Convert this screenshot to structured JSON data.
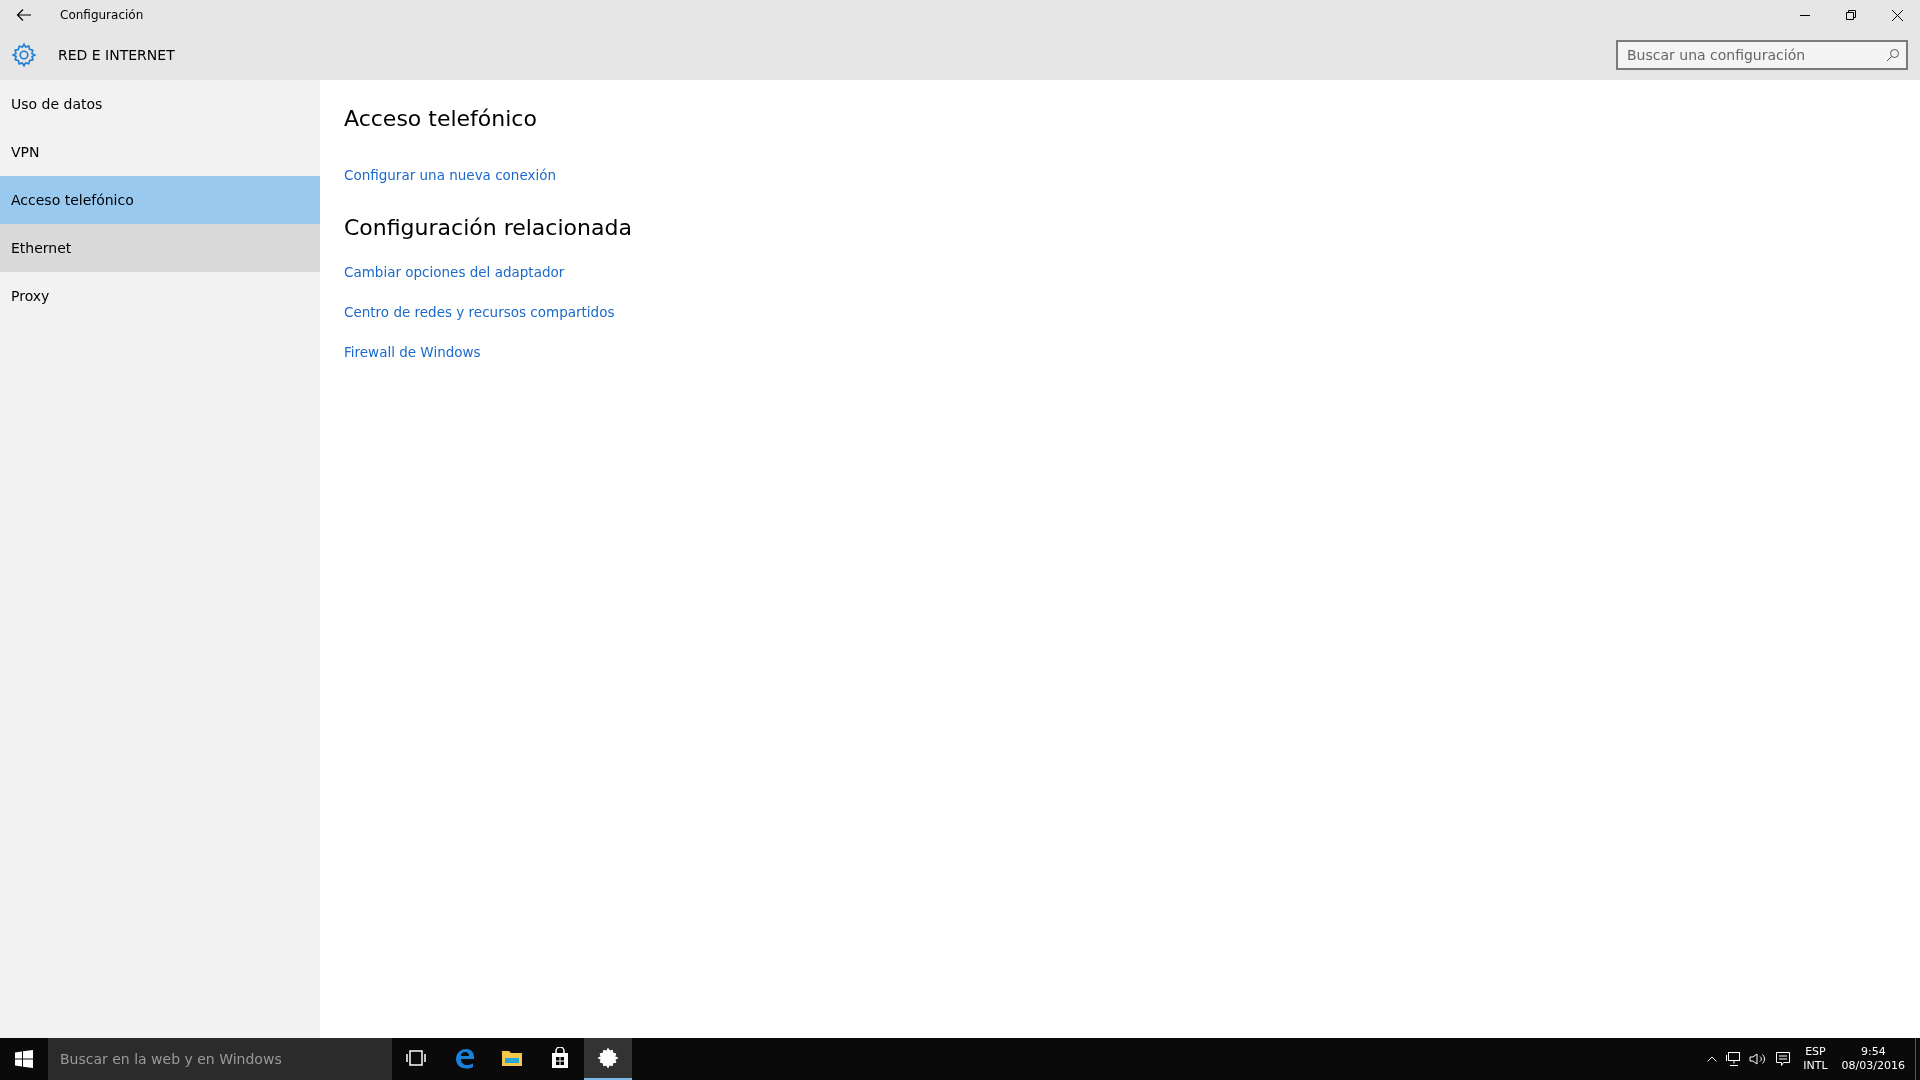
{
  "window": {
    "title": "Configuración",
    "section": "RED E INTERNET",
    "search": {
      "placeholder": "Buscar una configuración"
    }
  },
  "sidebar": {
    "items": [
      {
        "label": "Uso de datos",
        "selected": false,
        "hovered": false
      },
      {
        "label": "VPN",
        "selected": false,
        "hovered": false
      },
      {
        "label": "Acceso telefónico",
        "selected": true,
        "hovered": false
      },
      {
        "label": "Ethernet",
        "selected": false,
        "hovered": true
      },
      {
        "label": "Proxy",
        "selected": false,
        "hovered": false
      }
    ]
  },
  "content": {
    "heading": "Acceso telefónico",
    "links": [
      "Configurar una nueva conexión"
    ],
    "related": {
      "heading": "Configuración relacionada",
      "links": [
        "Cambiar opciones del adaptador",
        "Centro de redes y recursos compartidos",
        "Firewall de Windows"
      ]
    }
  },
  "taskbar": {
    "search": {
      "placeholder": "Buscar en la web y en Windows"
    },
    "apps": [
      {
        "kind": "taskview",
        "selected": false
      },
      {
        "kind": "edge",
        "selected": false
      },
      {
        "kind": "explorer",
        "selected": false
      },
      {
        "kind": "store",
        "selected": false
      },
      {
        "kind": "settings",
        "selected": true
      }
    ],
    "language": [
      "ESP",
      "INTL"
    ],
    "time": "9:54",
    "date": "08/03/2016"
  }
}
